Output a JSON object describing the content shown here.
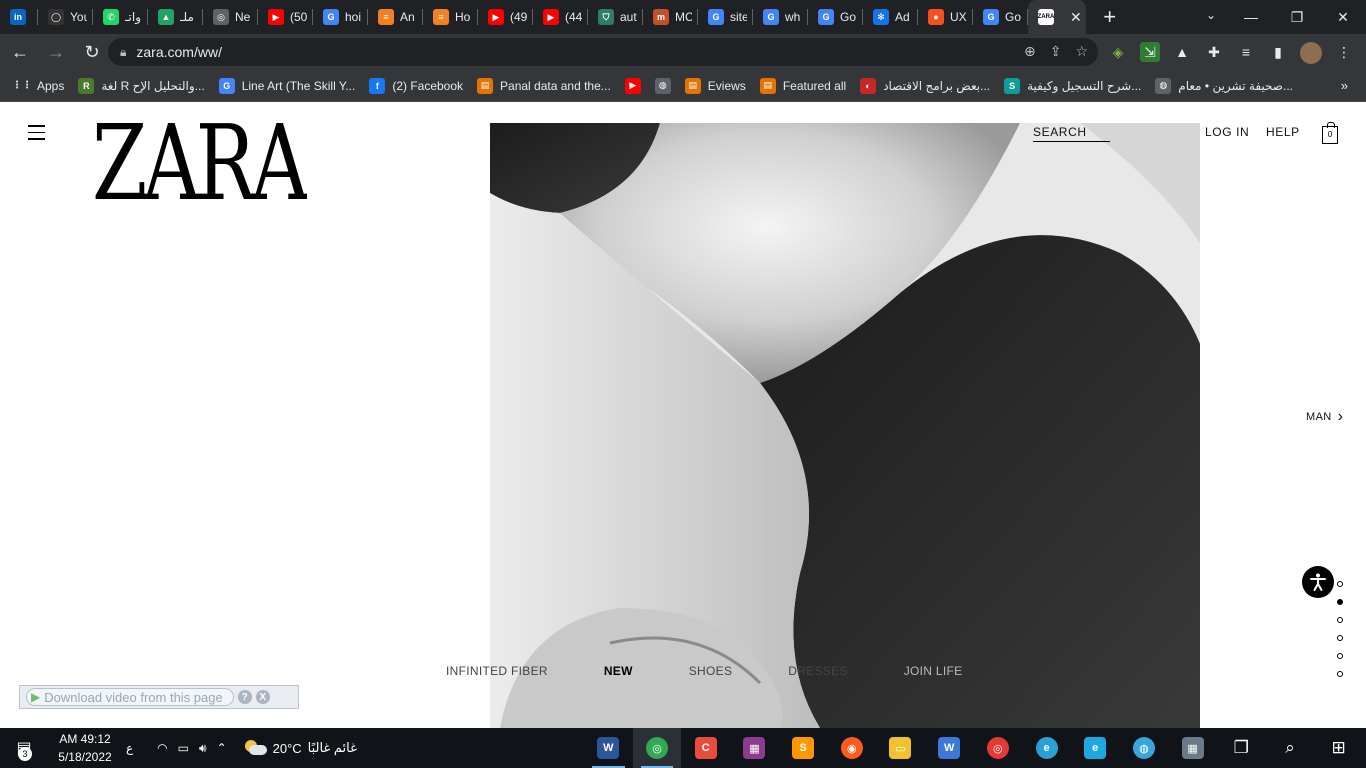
{
  "browser": {
    "tabs": [
      {
        "title": "",
        "icon": "linkedin-icon",
        "color": "#0a66c2",
        "glyph": "in"
      },
      {
        "title": "You",
        "icon": "github-icon",
        "color": "#333333",
        "glyph": "◯"
      },
      {
        "title": "واتـ",
        "icon": "whatsapp-icon",
        "color": "#25d366",
        "glyph": "✆"
      },
      {
        "title": "ملـ",
        "icon": "drive-icon",
        "color": "#1fa463",
        "glyph": "▲"
      },
      {
        "title": "Ne",
        "icon": "chrome-icon",
        "color": "#5f6368",
        "glyph": "◎"
      },
      {
        "title": "(50",
        "icon": "youtube-icon",
        "color": "#ff0000",
        "glyph": "▶"
      },
      {
        "title": "hoi",
        "icon": "google-icon",
        "color": "#4285f4",
        "glyph": "G"
      },
      {
        "title": "An",
        "icon": "stackoverflow-icon",
        "color": "#f48024",
        "glyph": "≡"
      },
      {
        "title": "Ho",
        "icon": "stackoverflow-icon",
        "color": "#f48024",
        "glyph": "≡"
      },
      {
        "title": "(49",
        "icon": "youtube-icon",
        "color": "#ff0000",
        "glyph": "▶"
      },
      {
        "title": "(44",
        "icon": "youtube-icon",
        "color": "#ff0000",
        "glyph": "▶"
      },
      {
        "title": "aut",
        "icon": "shield-icon",
        "color": "#2e7d6b",
        "glyph": "⛉"
      },
      {
        "title": "MC",
        "icon": "mc-icon",
        "color": "#c0522b",
        "glyph": "m"
      },
      {
        "title": "site",
        "icon": "google-icon",
        "color": "#4285f4",
        "glyph": "G"
      },
      {
        "title": "wh",
        "icon": "google-icon",
        "color": "#4285f4",
        "glyph": "G"
      },
      {
        "title": "Go",
        "icon": "translate-icon",
        "color": "#4285f4",
        "glyph": "G"
      },
      {
        "title": "Ad",
        "icon": "adobe-icon",
        "color": "#1473e6",
        "glyph": "✻"
      },
      {
        "title": "UX",
        "icon": "record-dot-icon",
        "color": "#f4511e",
        "glyph": "●"
      },
      {
        "title": "Go",
        "icon": "translate-icon",
        "color": "#4285f4",
        "glyph": "G"
      }
    ],
    "active_tab": {
      "icon": "zara-favicon-icon",
      "glyph": "ZARA",
      "color": "#ffffff"
    },
    "url": "zara.com/ww/",
    "bookmarks": [
      {
        "label": "Apps",
        "icon": "apps-grid-icon",
        "color": "#e8eaed",
        "glyph": "⋮⋮"
      },
      {
        "label": "لغة R والتحليل الإح...",
        "icon": "bookmark-r-icon",
        "color": "#4a7a2c",
        "glyph": "R"
      },
      {
        "label": "Line Art (The Skill Y...",
        "icon": "google-icon",
        "color": "#4285f4",
        "glyph": "G"
      },
      {
        "label": "(2) Facebook",
        "icon": "facebook-icon",
        "color": "#1877f2",
        "glyph": "f"
      },
      {
        "label": "Panal data and the...",
        "icon": "bookmark-doc-icon",
        "color": "#e37400",
        "glyph": "▤"
      },
      {
        "label": "",
        "icon": "youtube-icon",
        "color": "#ff0000",
        "glyph": "▶"
      },
      {
        "label": "",
        "icon": "globe-icon",
        "color": "#5f6368",
        "glyph": "◍"
      },
      {
        "label": "Eviews",
        "icon": "bookmark-doc-icon",
        "color": "#e37400",
        "glyph": "▤"
      },
      {
        "label": "Featured all",
        "icon": "bookmark-doc-icon",
        "color": "#e37400",
        "glyph": "▤"
      },
      {
        "label": "بعض برامج الاقتصاد...",
        "icon": "bookmark-eco-icon",
        "color": "#c62828",
        "glyph": "◐"
      },
      {
        "label": "شرح التسجيل وكيفية...",
        "icon": "bookmark-s-icon",
        "color": "#0f9d9a",
        "glyph": "S"
      },
      {
        "label": "صحيفة تشرين • معام...",
        "icon": "globe-icon",
        "color": "#5f6368",
        "glyph": "◍"
      }
    ]
  },
  "zara": {
    "logo": "ZARA",
    "search": "SEARCH",
    "login": "LOG IN",
    "help": "HELP",
    "bag_count": "0",
    "man_link": "MAN",
    "categories": [
      {
        "label": "INFINITED FIBER",
        "state": "normal"
      },
      {
        "label": "NEW",
        "state": "active"
      },
      {
        "label": "SHOES",
        "state": "normal"
      },
      {
        "label": "DRESSES",
        "state": "normal"
      },
      {
        "label": "JOIN LIFE",
        "state": "fade"
      }
    ],
    "slides_total": 6,
    "slide_active": 2
  },
  "download_bar": {
    "label": "Download video from this page",
    "help": "?",
    "close": "X"
  },
  "taskbar": {
    "notifications": "3",
    "time": "AM 49:12",
    "date": "5/18/2022",
    "lang": "ع",
    "temp": "20°C",
    "weather": "غائم غالبًا",
    "apps": [
      {
        "icon": "word-icon",
        "color": "#2b579a",
        "glyph": "W",
        "state": "running"
      },
      {
        "icon": "chrome-icon",
        "color": "#34a853",
        "glyph": "◎",
        "state": "active"
      },
      {
        "icon": "ccleaner-icon",
        "color": "#e84c3d",
        "glyph": "C",
        "state": ""
      },
      {
        "icon": "winrar-icon",
        "color": "#8e3b8f",
        "glyph": "▦",
        "state": ""
      },
      {
        "icon": "sublime-icon",
        "color": "#ff9800",
        "glyph": "S",
        "state": ""
      },
      {
        "icon": "firefox-icon",
        "color": "#ff5a1f",
        "glyph": "◉",
        "state": ""
      },
      {
        "icon": "file-explorer-icon",
        "color": "#f2c12e",
        "glyph": "▭",
        "state": ""
      },
      {
        "icon": "word-blue-icon",
        "color": "#3c78d8",
        "glyph": "W",
        "state": ""
      },
      {
        "icon": "opera-icon",
        "color": "#e53935",
        "glyph": "◎",
        "state": ""
      },
      {
        "icon": "edge-icon",
        "color": "#2aa0d8",
        "glyph": "e",
        "state": ""
      },
      {
        "icon": "internet-explorer-icon",
        "color": "#1ea7e1",
        "glyph": "e",
        "state": ""
      },
      {
        "icon": "app-ring-icon",
        "color": "#3aa5d9",
        "glyph": "◍",
        "state": ""
      },
      {
        "icon": "calculator-icon",
        "color": "#6a7a88",
        "glyph": "▦",
        "state": ""
      },
      {
        "icon": "task-view-icon",
        "color": "#101418",
        "glyph": "❐",
        "state": ""
      },
      {
        "icon": "search-icon",
        "color": "#101418",
        "glyph": "⌕",
        "state": ""
      },
      {
        "icon": "windows-start-icon",
        "color": "#101418",
        "glyph": "⊞",
        "state": ""
      }
    ]
  }
}
